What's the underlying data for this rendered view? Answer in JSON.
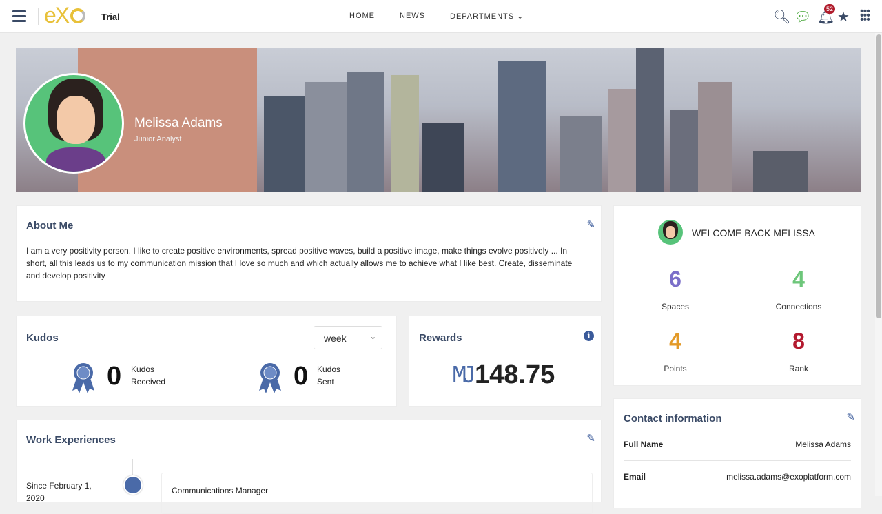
{
  "topbar": {
    "brand": "eXo",
    "workspace": "Trial",
    "nav": [
      "HOME",
      "NEWS",
      "DEPARTMENTS"
    ],
    "notifications_count": "52"
  },
  "profile": {
    "name": "Melissa Adams",
    "role": "Junior Analyst"
  },
  "about": {
    "title": "About Me",
    "text": "I am a very positivity person. I like to create positive environments, spread positive waves, build a positive image, make things evolve positively ... In short, all this leads us to my communication mission that I love so much and which actually allows me to achieve what I like best. Create, disseminate and develop positivity"
  },
  "kudos": {
    "title": "Kudos",
    "period": "week",
    "received_value": "0",
    "received_label1": "Kudos",
    "received_label2": "Received",
    "sent_value": "0",
    "sent_label1": "Kudos",
    "sent_label2": "Sent"
  },
  "rewards": {
    "title": "Rewards",
    "currency": "MJ",
    "value": "148.75"
  },
  "work": {
    "title": "Work Experiences",
    "since": "Since February 1, 2020",
    "position": "Communications Manager"
  },
  "welcome": {
    "title": "WELCOME BACK MELISSA",
    "stats": [
      {
        "value": "6",
        "label": "Spaces",
        "color": "#7b6fc9"
      },
      {
        "value": "4",
        "label": "Connections",
        "color": "#6dc67a"
      },
      {
        "value": "4",
        "label": "Points",
        "color": "#e39a28"
      },
      {
        "value": "8",
        "label": "Rank",
        "color": "#b3192e"
      }
    ]
  },
  "contact": {
    "title": "Contact information",
    "rows": [
      {
        "label": "Full Name",
        "value": "Melissa Adams"
      },
      {
        "label": "Email",
        "value": "melissa.adams@exoplatform.com"
      }
    ]
  }
}
